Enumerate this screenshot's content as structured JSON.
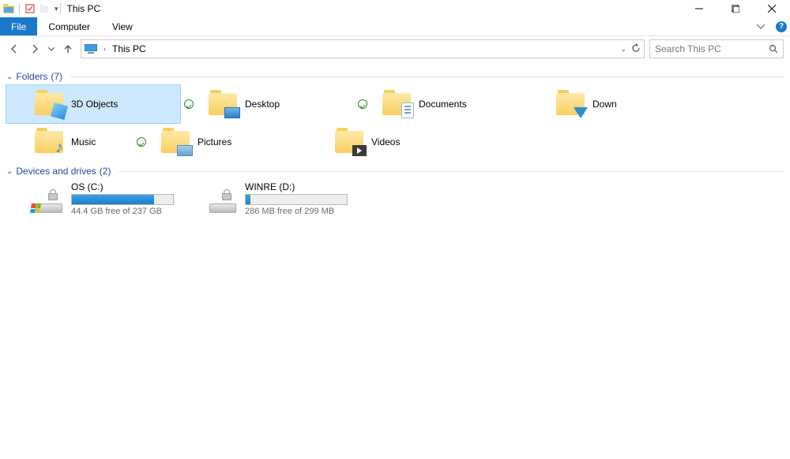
{
  "titlebar": {
    "title": "This PC"
  },
  "ribbon": {
    "tabs": {
      "file": "File",
      "computer": "Computer",
      "view": "View"
    }
  },
  "nav": {
    "breadcrumb": "This PC",
    "search_placeholder": "Search This PC"
  },
  "groups": {
    "folders": {
      "label": "Folders",
      "count": "(7)"
    },
    "drives": {
      "label": "Devices and drives",
      "count": "(2)"
    }
  },
  "folders": [
    {
      "label": "3D Objects"
    },
    {
      "label": "Desktop"
    },
    {
      "label": "Documents"
    },
    {
      "label": "Down"
    },
    {
      "label": "Music"
    },
    {
      "label": "Pictures"
    },
    {
      "label": "Videos"
    }
  ],
  "drives": [
    {
      "name": "OS (C:)",
      "free_text": "44.4 GB free of 237 GB",
      "fill_pct": 81
    },
    {
      "name": "WINRE (D:)",
      "free_text": "286 MB free of 299 MB",
      "fill_pct": 5
    }
  ]
}
